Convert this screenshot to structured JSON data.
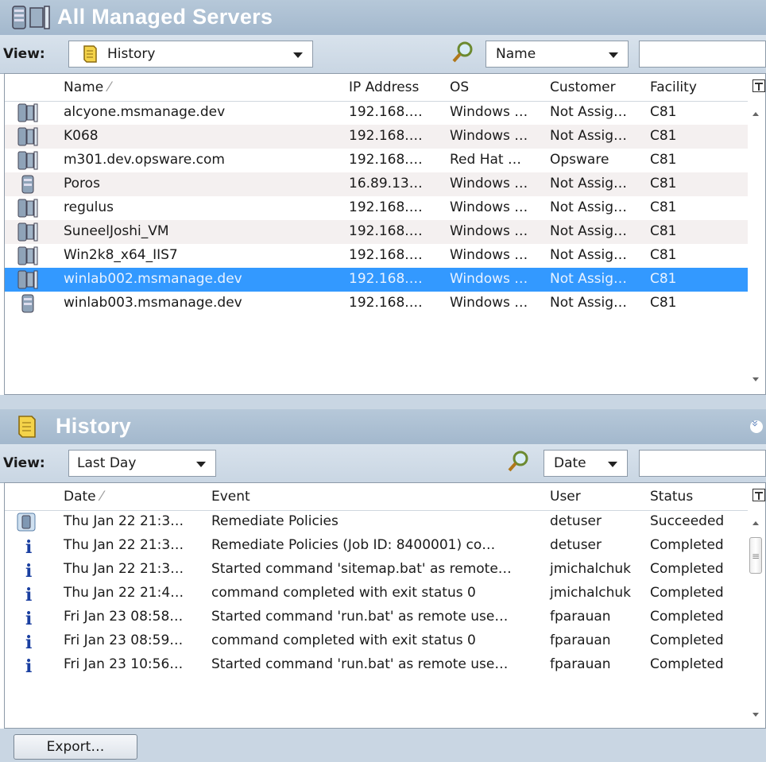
{
  "servers_panel": {
    "title": "All Managed Servers",
    "view_label": "View:",
    "view_value": "History",
    "search_field_value": "Name",
    "search_text": "",
    "columns": [
      "Name",
      "IP Address",
      "OS",
      "Customer",
      "Facility"
    ],
    "rows": [
      {
        "icon": "server-stack",
        "name": "alcyone.msmanage.dev",
        "ip": "192.168.…",
        "os": "Windows …",
        "customer": "Not Assig…",
        "facility": "C81"
      },
      {
        "icon": "server-stack",
        "name": "K068",
        "ip": "192.168.…",
        "os": "Windows …",
        "customer": "Not Assig…",
        "facility": "C81"
      },
      {
        "icon": "server-stack",
        "name": "m301.dev.opsware.com",
        "ip": "192.168.…",
        "os": "Red Hat …",
        "customer": "Opsware",
        "facility": "C81"
      },
      {
        "icon": "server-single",
        "name": "Poros",
        "ip": "16.89.13…",
        "os": "Windows …",
        "customer": "Not Assig…",
        "facility": "C81"
      },
      {
        "icon": "server-stack",
        "name": "regulus",
        "ip": "192.168.…",
        "os": "Windows …",
        "customer": "Not Assig…",
        "facility": "C81"
      },
      {
        "icon": "server-stack",
        "name": "SuneelJoshi_VM",
        "ip": "192.168.…",
        "os": "Windows …",
        "customer": "Not Assig…",
        "facility": "C81"
      },
      {
        "icon": "server-stack",
        "name": "Win2k8_x64_IIS7",
        "ip": "192.168.…",
        "os": "Windows …",
        "customer": "Not Assig…",
        "facility": "C81"
      },
      {
        "icon": "server-stack",
        "name": "winlab002.msmanage.dev",
        "ip": "192.168.…",
        "os": "Windows …",
        "customer": "Not Assig…",
        "facility": "C81",
        "selected": true
      },
      {
        "icon": "server-single",
        "name": "winlab003.msmanage.dev",
        "ip": "192.168.…",
        "os": "Windows …",
        "customer": "Not Assig…",
        "facility": "C81"
      }
    ]
  },
  "history_panel": {
    "title": "History",
    "view_label": "View:",
    "view_value": "Last Day",
    "search_field_value": "Date",
    "search_text": "",
    "columns": [
      "Date",
      "Event",
      "User",
      "Status"
    ],
    "rows": [
      {
        "icon": "policy-icon",
        "date": "Thu Jan 22 21:3…",
        "event": "Remediate Policies",
        "user": "detuser",
        "status": "Succeeded"
      },
      {
        "icon": "info-icon",
        "date": "Thu Jan 22 21:3…",
        "event": "Remediate Policies (Job ID: 8400001) co…",
        "user": "detuser",
        "status": "Completed"
      },
      {
        "icon": "info-icon",
        "date": "Thu Jan 22 21:3…",
        "event": "Started command 'sitemap.bat' as remote…",
        "user": "jmichalchuk",
        "status": "Completed"
      },
      {
        "icon": "info-icon",
        "date": "Thu Jan 22 21:4…",
        "event": "command completed with exit status 0",
        "user": "jmichalchuk",
        "status": "Completed"
      },
      {
        "icon": "info-icon",
        "date": "Fri Jan 23 08:58…",
        "event": "Started command 'run.bat' as remote use…",
        "user": "fparauan",
        "status": "Completed"
      },
      {
        "icon": "info-icon",
        "date": "Fri Jan 23 08:59…",
        "event": "command completed with exit status 0",
        "user": "fparauan",
        "status": "Completed"
      },
      {
        "icon": "info-icon",
        "date": "Fri Jan 23 10:56…",
        "event": "Started command 'run.bat' as remote use…",
        "user": "fparauan",
        "status": "Completed"
      }
    ],
    "export_label": "Export…"
  },
  "colors": {
    "title_bar": "#a9bdd1",
    "selection": "#3399ff",
    "info_icon": "#1a3fa0"
  }
}
